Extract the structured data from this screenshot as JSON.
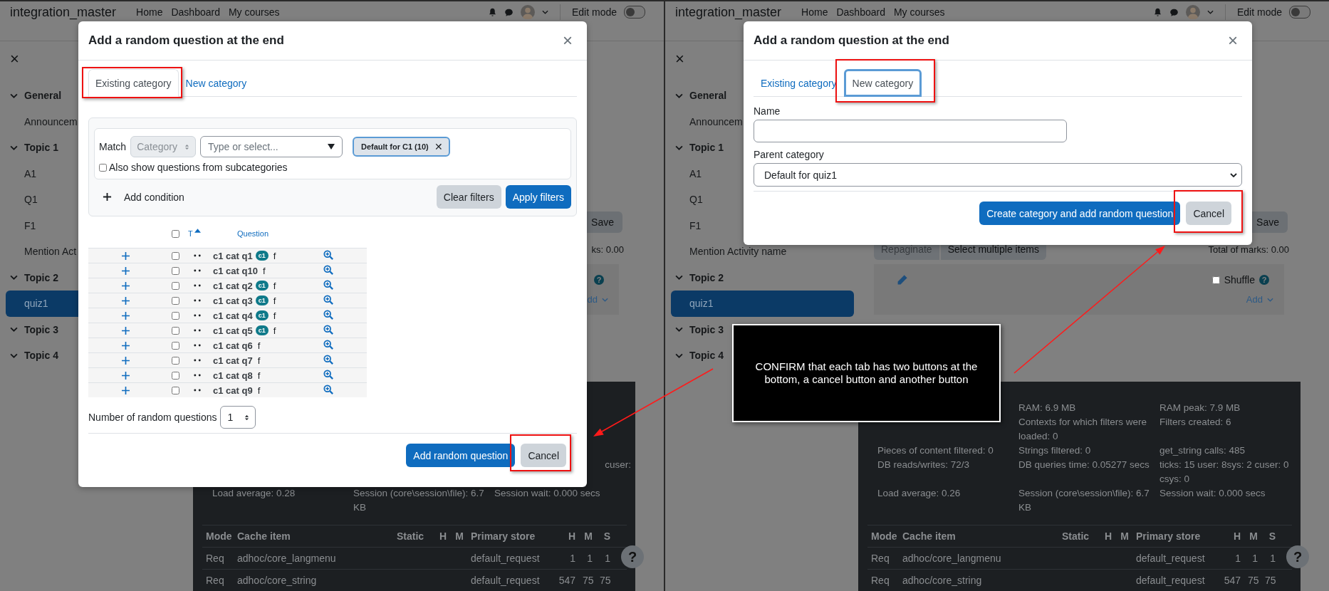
{
  "panels": [
    {
      "navbar": {
        "site_name": "integration_master",
        "links": [
          "Home",
          "Dashboard",
          "My courses"
        ],
        "edit_mode": {
          "label": "Edit mode",
          "on": false
        }
      },
      "sidebar": {
        "close": "×",
        "sections": [
          {
            "label": "General",
            "expanded": true,
            "children": [
              {
                "label": "Announcem",
                "selected": false
              }
            ]
          },
          {
            "label": "Topic 1",
            "expanded": true,
            "children": [
              {
                "label": "A1",
                "selected": false
              },
              {
                "label": "Q1",
                "selected": false
              },
              {
                "label": "F1",
                "selected": false
              },
              {
                "label": "Mention Act",
                "selected": false
              }
            ]
          },
          {
            "label": "Topic 2",
            "expanded": true,
            "children": [
              {
                "label": "quiz1",
                "selected": true
              }
            ]
          },
          {
            "label": "Topic 3",
            "expanded": true
          },
          {
            "label": "Topic 4",
            "expanded": true
          }
        ]
      },
      "content": {
        "save": "Save",
        "marks": "ks: 0.00",
        "help": "?",
        "add": "dd"
      },
      "footer": {
        "stats": [
          {
            "kind": "tail",
            "col_3": "cuser:"
          },
          {
            "kind": "full",
            "col_1": "Load average: 0.28",
            "col_2": "Session (core\\session\\file): 6.7 KB",
            "col_3": "Session wait: 0.000 secs"
          }
        ],
        "cache_table": {
          "columns": [
            "Mode",
            "Cache item",
            "Static",
            "H",
            "M",
            "Primary store",
            "H",
            "M",
            "S"
          ],
          "rows": [
            {
              "mode": "Req",
              "cache_item": "adhoc/core_langmenu",
              "primary_store": "default_request",
              "h": "1",
              "m": "1",
              "s": "1"
            },
            {
              "mode": "Req",
              "cache_item": "adhoc/core_string",
              "primary_store": "default_request",
              "h": "547",
              "m": "75",
              "s": "75"
            }
          ]
        }
      },
      "help": "?",
      "modal": {
        "title": "Add a random question at the end",
        "close": "×",
        "tabs": [
          {
            "label": "Existing category",
            "selected": true,
            "focused": false
          },
          {
            "label": "New category",
            "selected": false,
            "focused": false
          }
        ],
        "body": {
          "kind": "existing",
          "match_label": "Match",
          "condition_type": "Category",
          "search_placeholder": "Type or select...",
          "chip": "Default for C1 (10)",
          "chip_remove": "✕",
          "subcategories": {
            "label": "Also show questions from subcategories",
            "checked": false
          },
          "add_condition": "Add condition",
          "clear_filters": "Clear filters",
          "apply_filters": "Apply filters",
          "table": {
            "select_all_checked": false,
            "type_header": "T",
            "question_header": "Question",
            "rows": [
              {
                "name": "c1 cat q1",
                "tag": "c1",
                "note": "f",
                "checked": false
              },
              {
                "name": "c1 cat q10",
                "note": "f",
                "checked": false
              },
              {
                "name": "c1 cat q2",
                "tag": "c1",
                "note": "f",
                "checked": false
              },
              {
                "name": "c1 cat q3",
                "tag": "c1",
                "note": "f",
                "checked": false
              },
              {
                "name": "c1 cat q4",
                "tag": "c1",
                "note": "f",
                "checked": false
              },
              {
                "name": "c1 cat q5",
                "tag": "c1",
                "note": "f",
                "checked": false
              },
              {
                "name": "c1 cat q6",
                "note": "f",
                "checked": false
              },
              {
                "name": "c1 cat q7",
                "note": "f",
                "checked": false
              },
              {
                "name": "c1 cat q8",
                "note": "f",
                "checked": false
              },
              {
                "name": "c1 cat q9",
                "note": "f",
                "checked": false
              }
            ]
          },
          "count_label": "Number of random questions",
          "count": "1"
        },
        "buttons": [
          {
            "label": "Add random question",
            "kind": "primary"
          },
          {
            "label": "Cancel",
            "kind": "secondary"
          }
        ]
      }
    },
    {
      "navbar": {
        "site_name": "integration_master",
        "links": [
          "Home",
          "Dashboard",
          "My courses"
        ],
        "edit_mode": {
          "label": "Edit mode",
          "on": false
        }
      },
      "sidebar": {
        "close": "×",
        "sections": [
          {
            "label": "General",
            "expanded": true,
            "children": [
              {
                "label": "Announcem",
                "selected": false
              }
            ]
          },
          {
            "label": "Topic 1",
            "expanded": true,
            "children": [
              {
                "label": "A1",
                "selected": false
              },
              {
                "label": "Q1",
                "selected": false
              },
              {
                "label": "F1",
                "selected": false
              },
              {
                "label": "Mention Activity name",
                "selected": false
              }
            ]
          },
          {
            "label": "Topic 2",
            "expanded": true,
            "children": [
              {
                "label": "quiz1",
                "selected": true
              }
            ]
          },
          {
            "label": "Topic 3",
            "expanded": true
          },
          {
            "label": "Topic 4",
            "expanded": true
          }
        ]
      },
      "content": {
        "save": "Save",
        "repaginate": "Repaginate",
        "select_multiple": "Select multiple items",
        "marks": "Total of marks: 0.00",
        "shuffle": {
          "label": "Shuffle",
          "checked": false
        },
        "help": "?",
        "add": "Add"
      },
      "footer": {
        "stats": [
          {
            "kind": "full",
            "col_2": "RAM: 6.9 MB",
            "col_3": "RAM peak: 7.9 MB"
          },
          {
            "kind": "full",
            "col_2": "Contexts for which filters were loaded: 0",
            "col_3": "Filters created: 6"
          },
          {
            "kind": "full",
            "col_1": "Pieces of content filtered: 0",
            "col_2": "Strings filtered: 0",
            "col_3": "get_string calls: 485"
          },
          {
            "kind": "full",
            "col_1": "DB reads/writes: 72/3",
            "col_2": "DB queries time: 0.05277 secs",
            "col_3": "ticks: 15 user: 8sys: 2 cuser: 0 csys: 0"
          },
          {
            "kind": "full",
            "col_1": "Load average: 0.26",
            "col_2": "Session (core\\session\\file): 6.7 KB",
            "col_3": "Session wait: 0.000 secs"
          }
        ],
        "cache_table": {
          "columns": [
            "Mode",
            "Cache item",
            "Static",
            "H",
            "M",
            "Primary store",
            "H",
            "M",
            "S"
          ],
          "rows": [
            {
              "mode": "Req",
              "cache_item": "adhoc/core_langmenu",
              "primary_store": "default_request",
              "h": "1",
              "m": "1",
              "s": "1"
            },
            {
              "mode": "Req",
              "cache_item": "adhoc/core_string",
              "primary_store": "default_request",
              "h": "547",
              "m": "75",
              "s": "75"
            }
          ]
        }
      },
      "help": "?",
      "modal": {
        "title": "Add a random question at the end",
        "close": "×",
        "tabs": [
          {
            "label": "Existing category",
            "selected": false,
            "focused": false
          },
          {
            "label": "New category",
            "selected": true,
            "focused": true
          }
        ],
        "body": {
          "kind": "new",
          "name_label": "Name",
          "parent_label": "Parent category",
          "parent_value": "Default for quiz1"
        },
        "buttons": [
          {
            "label": "Create category and add random question",
            "kind": "primary"
          },
          {
            "label": "Cancel",
            "kind": "secondary"
          }
        ]
      }
    }
  ],
  "annotation": {
    "callout": "CONFIRM that each tab has two buttons at the bottom, a cancel button and another button"
  }
}
